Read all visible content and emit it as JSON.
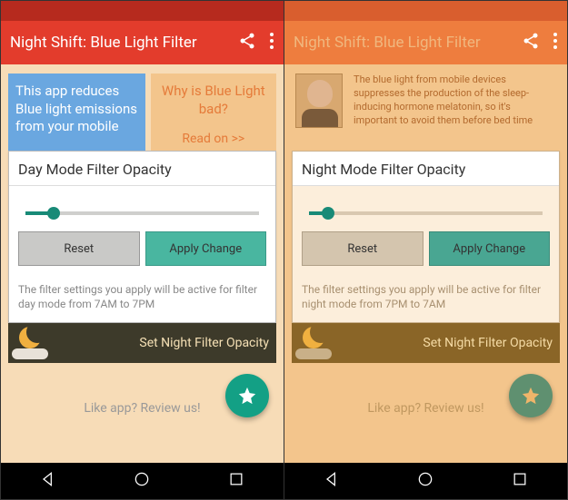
{
  "left": {
    "statusbar_color": "#b62a1e",
    "appbar_color": "#e33c2c",
    "title": "Night Shift: Blue Light Filter",
    "info1": "This app reduces Blue light emissions from your mobile",
    "info2_line1": "Why is Blue Light bad?",
    "info2_line2": "Read on >>",
    "card_title": "Day Mode Filter Opacity",
    "slider_percent": 12,
    "reset_label": "Reset",
    "apply_label": "Apply Change",
    "help_text": "The filter settings you apply will be active for filter day mode from 7AM to 7PM",
    "night_bar_label": "Set Night Filter Opacity",
    "review_label": "Like app? Review us!"
  },
  "right": {
    "statusbar_color": "#d95e2e",
    "appbar_color": "#ee7d3e",
    "title": "Night Shift: Blue Light Filter",
    "info_text": "The blue light from mobile devices suppresses the production of the sleep-inducing hormone melatonin, so it's important to avoid them before bed time",
    "card_title": "Night Mode Filter Opacity",
    "slider_percent": 8,
    "reset_label": "Reset",
    "apply_label": "Apply Change",
    "help_text": "The filter settings you apply will be active for filter night mode from 7PM to 7AM",
    "night_bar_label": "Set Night Filter Opacity",
    "review_label": "Like app? Review us!"
  }
}
